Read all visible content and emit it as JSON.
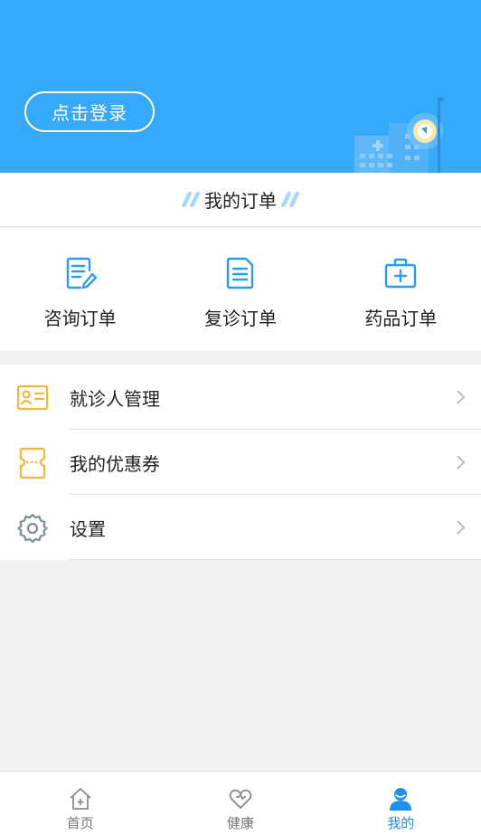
{
  "header": {
    "login_label": "点击登录",
    "bg_color": "#36a9fb"
  },
  "orders": {
    "title": "我的订单",
    "items": [
      {
        "label": "咨询订单",
        "icon": "edit-document-icon"
      },
      {
        "label": "复诊订单",
        "icon": "document-icon"
      },
      {
        "label": "药品订单",
        "icon": "medical-kit-icon"
      }
    ]
  },
  "menu": {
    "items": [
      {
        "label": "就诊人管理",
        "icon": "id-card-icon"
      },
      {
        "label": "我的优惠券",
        "icon": "coupon-icon"
      },
      {
        "label": "设置",
        "icon": "gear-icon"
      }
    ]
  },
  "tabbar": {
    "tabs": [
      {
        "label": "首页",
        "icon": "home-icon",
        "active": false
      },
      {
        "label": "健康",
        "icon": "heart-icon",
        "active": false
      },
      {
        "label": "我的",
        "icon": "user-icon",
        "active": true
      }
    ],
    "active_color": "#1e90f0"
  }
}
